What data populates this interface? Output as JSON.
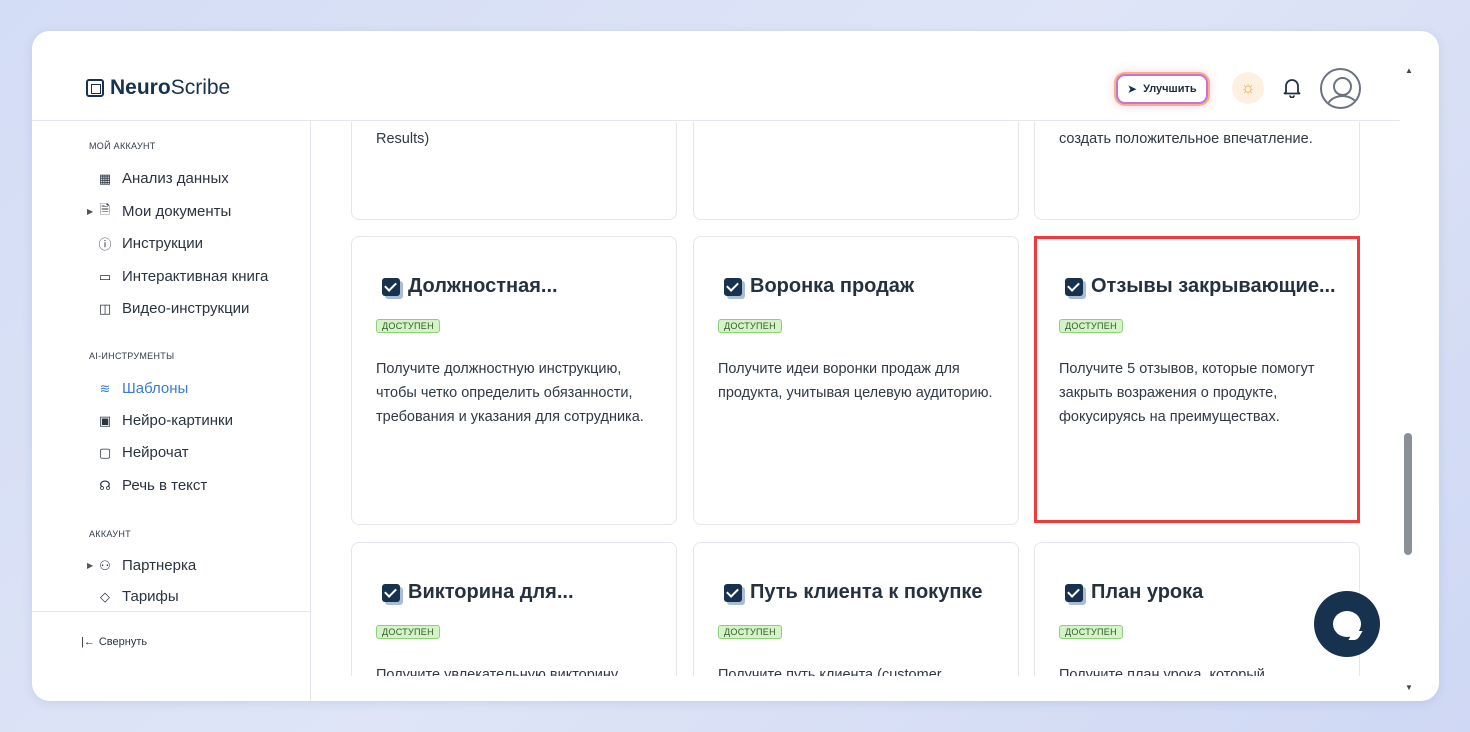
{
  "brand": {
    "bold": "Neuro",
    "regular": "Scribe"
  },
  "header": {
    "upgrade_label": "Улучшить"
  },
  "sidebar": {
    "section_account": "МОЙ АККАУНТ",
    "section_ai": "AI-ИНСТРУМЕНТЫ",
    "section_acc2": "АККАУНТ",
    "items": [
      {
        "label": "Анализ данных"
      },
      {
        "label": "Мои документы"
      },
      {
        "label": "Инструкции"
      },
      {
        "label": "Интерактивная книга"
      },
      {
        "label": "Видео-инструкции"
      },
      {
        "label": "Шаблоны"
      },
      {
        "label": "Нейро-картинки"
      },
      {
        "label": "Нейрочат"
      },
      {
        "label": "Речь в текст"
      },
      {
        "label": "Партнерка"
      },
      {
        "label": "Тарифы"
      }
    ],
    "collapse_label": "Свернуть",
    "collapse_arrow": "|←"
  },
  "cards_top": [
    {
      "desc": "Results)"
    },
    {
      "desc": ""
    },
    {
      "desc": "создать положительное впечатление."
    }
  ],
  "cards": [
    {
      "title": "Должностная...",
      "badge": "ДОСТУПЕН",
      "desc": "Получите должностную инструкцию, чтобы четко определить обязанности, требования и указания для сотрудника."
    },
    {
      "title": "Воронка продаж",
      "badge": "ДОСТУПЕН",
      "desc": "Получите идеи воронки продаж для продукта, учитывая целевую аудиторию."
    },
    {
      "title": "Отзывы закрывающие...",
      "badge": "ДОСТУПЕН",
      "desc": "Получите 5 отзывов, которые помогут закрыть возражения о продукте, фокусируясь на преимуществах."
    },
    {
      "title": "Викторина для...",
      "badge": "ДОСТУПЕН",
      "desc": "Получите увлекательную викторину"
    },
    {
      "title": "Путь клиента к покупке",
      "badge": "ДОСТУПЕН",
      "desc": "Получите путь клиента (customer"
    },
    {
      "title": "План урока",
      "badge": "ДОСТУПЕН",
      "desc": "Получите план урока, который"
    }
  ],
  "colors": {
    "primary": "#16324f",
    "active": "#3a7bd5",
    "highlight": "#ef3b3b",
    "badge_bg": "#d4f3c7"
  }
}
